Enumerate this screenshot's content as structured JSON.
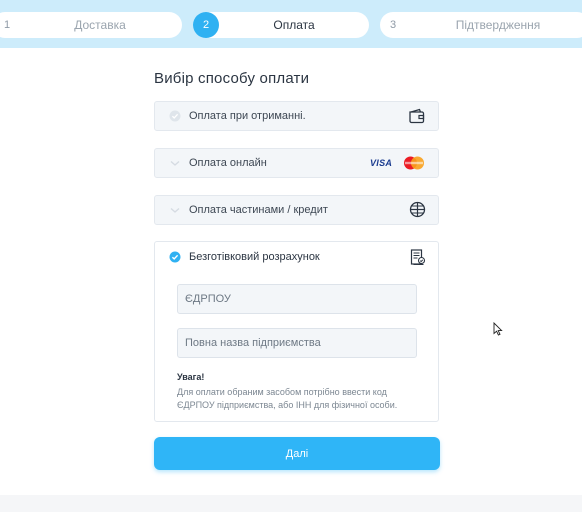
{
  "stepper": {
    "steps": [
      {
        "number": "1",
        "label": "Доставка",
        "state": "done"
      },
      {
        "number": "2",
        "label": "Оплата",
        "state": "active"
      },
      {
        "number": "3",
        "label": "Підтвердження",
        "state": "pending"
      }
    ]
  },
  "title": "Вибір способу оплати",
  "options": [
    {
      "label": "Оплата при отриманні.",
      "icon": "wallet-icon",
      "selected": false
    },
    {
      "label": "Оплата онлайн",
      "icon": "card-logos",
      "badges": [
        "VISA"
      ],
      "selected": false
    },
    {
      "label": "Оплата частинами / кредит",
      "icon": "globe-grid-icon",
      "selected": false
    },
    {
      "label": "Безготівковий розрахунок",
      "icon": "invoice-icon",
      "selected": true
    }
  ],
  "form": {
    "edrpou_placeholder": "ЄДРПОУ",
    "company_placeholder": "Повна назва підприємства",
    "note_title": "Увага!",
    "note_text": "Для оплати обраним засобом потрібно ввести код ЄДРПОУ підприємства, або ІНН для фізичної особи."
  },
  "next_label": "Далі",
  "colors": {
    "accent": "#2fb5f7",
    "stepper_bg": "#cdecfb",
    "option_bg": "#f3f6f9"
  }
}
